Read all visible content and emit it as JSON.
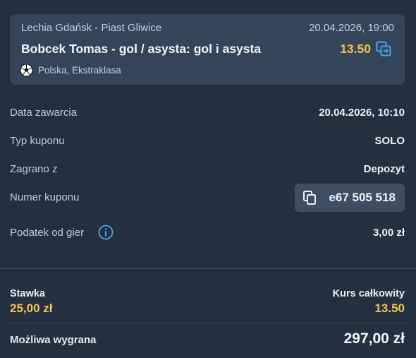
{
  "event": {
    "match": "Lechia Gdańsk - Piast Gliwice",
    "datetime": "20.04.2026, 19:00",
    "selection": "Bobcek Tomas - gol / asysta: gol i asysta",
    "odds": "13.50",
    "league": "Polska, Ekstraklasa",
    "sport_icon": "soccer-ball-icon",
    "action_icon": "swap-icon"
  },
  "details": {
    "date_label": "Data zawarcia",
    "date_value": "20.04.2026, 10:10",
    "type_label": "Typ kuponu",
    "type_value": "SOLO",
    "played_label": "Zagrano z",
    "played_value": "Depozyt",
    "coupon_label": "Numer kuponu",
    "coupon_value": "e67 505 518",
    "tax_label": "Podatek od gier",
    "tax_value": "3,00 zł"
  },
  "summary": {
    "stake_label": "Stawka",
    "stake_value": "25,00 zł",
    "total_odds_label": "Kurs całkowity",
    "total_odds_value": "13.50",
    "win_label": "Możliwa wygrana",
    "win_value": "297,00 zł"
  },
  "colors": {
    "background": "#24303f",
    "card": "#34455a",
    "accent_gold": "#f5c24b",
    "accent_blue": "#4aa3f0"
  }
}
